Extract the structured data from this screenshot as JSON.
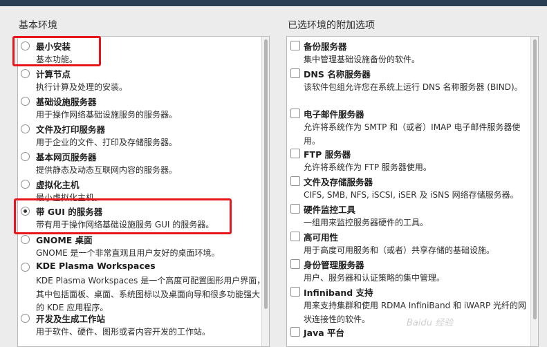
{
  "base_env": {
    "title": "基本环境",
    "options": [
      {
        "label": "最小安装",
        "desc": "基本功能。",
        "selected": false
      },
      {
        "label": "计算节点",
        "desc": "执行计算及处理的安装。",
        "selected": false
      },
      {
        "label": "基础设施服务器",
        "desc": "用于操作网络基础设施服务的服务器。",
        "selected": false
      },
      {
        "label": "文件及打印服务器",
        "desc": "用于企业的文件、打印及存储服务器。",
        "selected": false
      },
      {
        "label": "基本网页服务器",
        "desc": "提供静态及动态互联网内容的服务器。",
        "selected": false
      },
      {
        "label": "虚拟化主机",
        "desc": "最小虚拟化主机。",
        "selected": false
      },
      {
        "label": "带 GUI 的服务器",
        "desc": "带有用于操作网络基础设施服务 GUI 的服务器。",
        "selected": true
      },
      {
        "label": "GNOME 桌面",
        "desc": "GNOME 是一个非常直观且用户友好的桌面环境。",
        "selected": false
      },
      {
        "label": "KDE Plasma Workspaces",
        "desc": "KDE Plasma Workspaces 是一个高度可配置图形用户界面，其中包括面板、桌面、系统图标以及桌面向导和很多功能强大的 KDE 应用程序。",
        "selected": false
      },
      {
        "label": "开发及生成工作站",
        "desc": "用于软件、硬件、图形或者内容开发的工作站。",
        "selected": false
      }
    ]
  },
  "addons": {
    "title": "已选环境的附加选项",
    "options": [
      {
        "label": "备份服务器",
        "desc": "集中管理基础设施备份的软件。",
        "checked": false
      },
      {
        "label": "DNS 名称服务器",
        "desc": "该软件包组允许您在系统上运行 DNS 名称服务器 (BIND)。",
        "checked": false
      },
      {
        "label": "电子邮件服务器",
        "desc": "允许将系统作为 SMTP 和（或者）IMAP 电子邮件服务器使用。",
        "checked": false
      },
      {
        "label": "FTP 服务器",
        "desc": "允许将系统作为 FTP 服务器使用。",
        "checked": false
      },
      {
        "label": "文件及存储服务器",
        "desc": "CIFS, SMB, NFS, iSCSI, iSER 及 iSNS 网络存储服务器。",
        "checked": false
      },
      {
        "label": "硬件监控工具",
        "desc": "一组用来监控服务器硬件的工具。",
        "checked": false
      },
      {
        "label": "高可用性",
        "desc": "用于高度可用服务和（或者）共享存储的基础设施。",
        "checked": false
      },
      {
        "label": "身份管理服务器",
        "desc": "用户、服务器和认证策略的集中管理。",
        "checked": false
      },
      {
        "label": "Infiniband 支持",
        "desc": "用来支持集群和使用 RDMA InfiniBand 和 iWARP 光纤的网状连接性的软件。",
        "checked": false
      },
      {
        "label": "Java 平台",
        "desc": "",
        "checked": false
      }
    ]
  },
  "watermark": "Baidu 经验"
}
